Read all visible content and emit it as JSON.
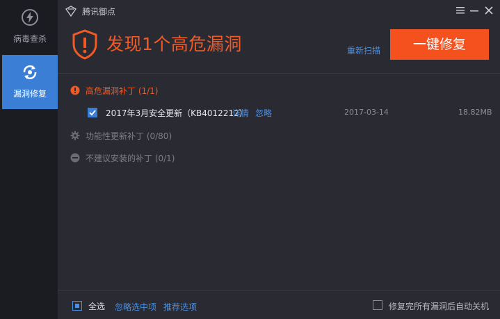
{
  "app": {
    "title": "腾讯御点"
  },
  "sidebar": {
    "items": [
      {
        "label": "病毒查杀",
        "icon": "lightning-icon",
        "active": false
      },
      {
        "label": "漏洞修复",
        "icon": "refresh-repair-icon",
        "active": true
      }
    ]
  },
  "window": {
    "menu_icon": "menu-icon",
    "min_icon": "minimize-icon",
    "close_icon": "close-icon"
  },
  "hero": {
    "headline": "发现1个高危漏洞",
    "rescan_label": "重新扫描",
    "fix_button_label": "一键修复"
  },
  "categories": {
    "high": {
      "label": "高危漏洞补丁 (1/1)",
      "icon": "alert-circle-icon"
    },
    "functional": {
      "label": "功能性更新补丁 (0/80)",
      "icon": "gear-icon"
    },
    "not_recommended": {
      "label": "不建议安装的补丁 (0/1)",
      "icon": "minus-circle-icon"
    }
  },
  "patches": [
    {
      "name": "2017年3月安全更新（KB4012212）",
      "details_label": "详情",
      "ignore_label": "忽略",
      "date": "2017-03-14",
      "size": "18.82MB",
      "checked": true
    }
  ],
  "footer": {
    "select_all_label": "全选",
    "ignore_selected_label": "忽略选中项",
    "recommend_label": "推荐选项",
    "shutdown_label": "修复完所有漏洞后自动关机"
  },
  "colors": {
    "accent": "#3a7fd5",
    "danger": "#f15a24",
    "fix_button": "#f4511e",
    "link": "#4a90e2"
  }
}
